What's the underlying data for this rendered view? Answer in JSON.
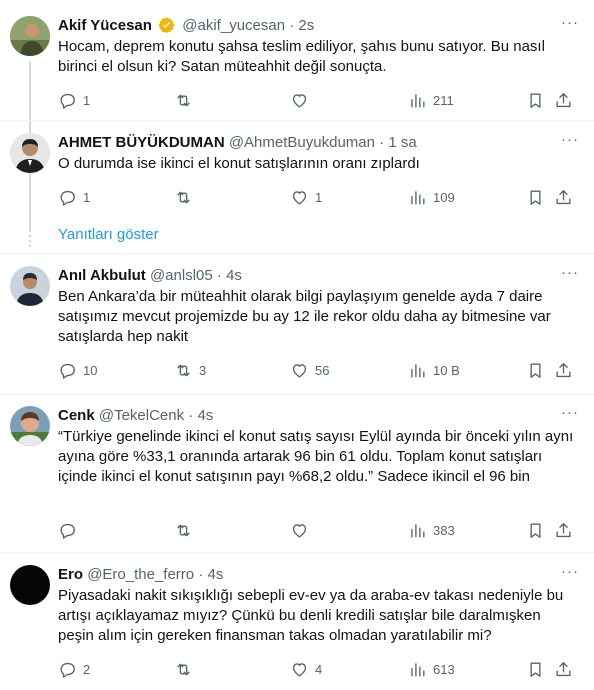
{
  "tweets": [
    {
      "name": "Akif Yücesan",
      "handle": "@akif_yucesan",
      "dot": "·",
      "time": "2s",
      "text": "Hocam, deprem konutu şahsa teslim ediliyor, şahıs bunu satıyor. Bu nasıl birinci el olsun ki? Satan müteahhit değil sonuçta.",
      "replies": "1",
      "retweets": "",
      "likes": "",
      "views": "211"
    },
    {
      "name": "AHMET BÜYÜKDUMAN",
      "handle": "@AhmetBuyukduman",
      "dot": "·",
      "time": "1 sa",
      "text": "O durumda ise  ikinci el konut satışlarının oranı zıplardı",
      "replies": "1",
      "retweets": "",
      "likes": "1",
      "views": "109"
    },
    {
      "name": "Anıl Akbulut",
      "handle": "@anlsl05",
      "dot": "·",
      "time": "4s",
      "text": "Ben Ankara’da bir müteahhit olarak bilgi paylaşıyım genelde ayda 7 daire satışımız mevcut projemizde bu ay 12 ile rekor oldu daha ay bitmesine var satışlarda hep nakit",
      "replies": "10",
      "retweets": "3",
      "likes": "56",
      "views": "10 B"
    },
    {
      "name": "Cenk",
      "handle": "@TekelCenk",
      "dot": "·",
      "time": "4s",
      "text": "“Türkiye genelinde ikinci el konut satış sayısı Eylül ayında bir önceki yılın aynı ayına göre %33,1 oranında artarak 96 bin 61 oldu. Toplam konut satışları içinde ikinci el konut satışının payı %68,2 oldu.” Sadece ikincil el 96 bin",
      "replies": "",
      "retweets": "",
      "likes": "",
      "views": "383"
    },
    {
      "name": "Ero",
      "handle": "@Ero_the_ferro",
      "dot": "·",
      "time": "4s",
      "text": "Piyasadaki nakit sıkışıklığı sebepli ev-ev ya da araba-ev takası nedeniyle bu artışı açıklayamaz mıyız? Çünkü bu denli kredili satışlar bile daralmışken peşin alım için gereken finansman takas olmadan yaratılabilir mi?",
      "replies": "2",
      "retweets": "",
      "likes": "4",
      "views": "613"
    }
  ],
  "show_replies_label": "Yanıtları göster",
  "more_icon": "ellipsis-icon",
  "icons": [
    "reply-icon",
    "retweet-icon",
    "like-icon",
    "views-icon",
    "bookmark-icon",
    "share-icon",
    "verified-badge-icon"
  ],
  "colors": {
    "accent": "#1d9bf0",
    "muted": "#536471",
    "text": "#0f1419",
    "verified": "#f4b400"
  }
}
